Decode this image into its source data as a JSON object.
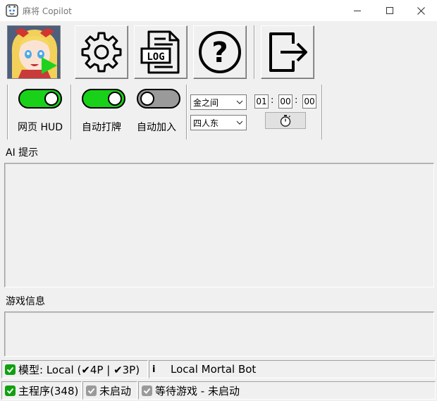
{
  "window": {
    "title": "麻将 Copilot"
  },
  "toolbar": {
    "buttons": [
      {
        "name": "avatar",
        "icon": "avatar-play-icon"
      },
      {
        "name": "settings",
        "icon": "gear-icon"
      },
      {
        "name": "log",
        "icon": "log-file-icon",
        "icon_text": "LOG"
      },
      {
        "name": "help",
        "icon": "question-icon",
        "icon_text": "?"
      },
      {
        "name": "exit",
        "icon": "exit-icon"
      }
    ]
  },
  "controls": {
    "web_hud": {
      "label": "网页 HUD",
      "on": true
    },
    "auto_play": {
      "label": "自动打牌",
      "on": true
    },
    "auto_join": {
      "label": "自动加入",
      "on": false
    },
    "room_select": {
      "value": "金之间"
    },
    "mode_select": {
      "value": "四人东"
    },
    "timer": {
      "hours": "01",
      "minutes": "00",
      "seconds": "00",
      "sep": ":"
    }
  },
  "sections": {
    "ai_hint": {
      "label": "AI 提示"
    },
    "game_info": {
      "label": "游戏信息"
    }
  },
  "status": {
    "model": "模型: Local (✔4P | ✔3P)",
    "bot_info_icon": "i",
    "bot_name": "Local Mortal Bot",
    "main_program": "主程序(348)",
    "not_started": "未启动",
    "waiting": "等待游戏 - 未启动"
  },
  "colors": {
    "toggle_on": "#19d119",
    "toggle_off": "#9a9a9a",
    "check_green": "#10a010",
    "check_gray": "#9a9a9a"
  }
}
